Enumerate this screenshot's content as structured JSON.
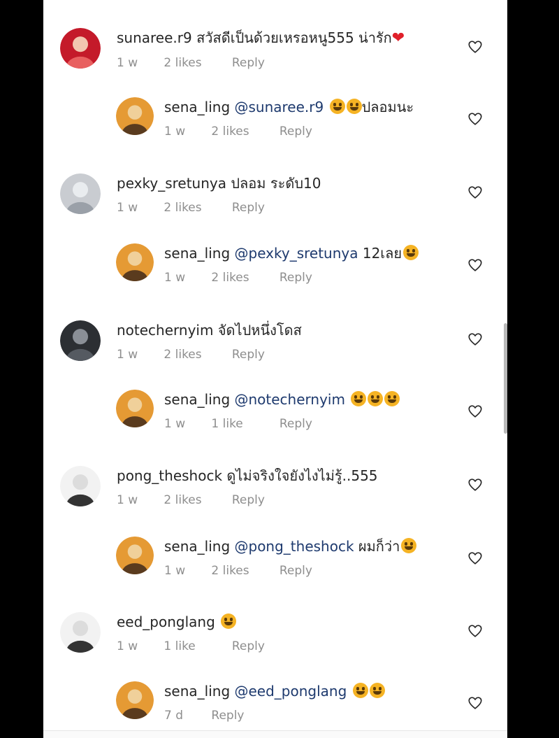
{
  "comments": [
    {
      "kind": "top",
      "user": "sunaree.r9",
      "mention": "",
      "text": "สวัสดีเป็นด้วยเหรอหนู555 น่ารัก",
      "tail": "heart",
      "time": "1 w",
      "likes": "2 likes",
      "reply": "Reply",
      "avatar": "red"
    },
    {
      "kind": "reply",
      "user": "sena_ling",
      "mention": "@sunaree.r9",
      "text": "ปลอมนะ",
      "pre_emoji": 2,
      "time": "1 w",
      "likes": "2 likes",
      "reply": "Reply",
      "avatar": "orange"
    },
    {
      "kind": "top",
      "user": "pexky_sretunya",
      "mention": "",
      "text": "ปลอม ระดับ10",
      "time": "1 w",
      "likes": "2 likes",
      "reply": "Reply",
      "avatar": "grey"
    },
    {
      "kind": "reply",
      "user": "sena_ling",
      "mention": "@pexky_sretunya",
      "text": "12เลย",
      "post_emoji": 1,
      "time": "1 w",
      "likes": "2 likes",
      "reply": "Reply",
      "avatar": "orange"
    },
    {
      "kind": "top",
      "user": "notechernyim",
      "mention": "",
      "text": "จัดไปหนึ่งโดส",
      "time": "1 w",
      "likes": "2 likes",
      "reply": "Reply",
      "avatar": "dark"
    },
    {
      "kind": "reply",
      "user": "sena_ling",
      "mention": "@notechernyim",
      "text": "",
      "post_emoji": 3,
      "time": "1 w",
      "likes": "1 like",
      "reply": "Reply",
      "avatar": "orange"
    },
    {
      "kind": "top",
      "user": "pong_theshock",
      "mention": "",
      "text": "ดูไม่จริงใจยังไงไม่รู้..555",
      "time": "1 w",
      "likes": "2 likes",
      "reply": "Reply",
      "avatar": "white"
    },
    {
      "kind": "reply",
      "user": "sena_ling",
      "mention": "@pong_theshock",
      "text": "ผมก็ว่า",
      "post_emoji": 1,
      "time": "1 w",
      "likes": "2 likes",
      "reply": "Reply",
      "avatar": "orange"
    },
    {
      "kind": "top",
      "user": "eed_ponglang",
      "mention": "",
      "text": "",
      "post_emoji": 1,
      "time": "1 w",
      "likes": "1 like",
      "reply": "Reply",
      "avatar": "white"
    },
    {
      "kind": "reply",
      "user": "sena_ling",
      "mention": "@eed_ponglang",
      "text": "",
      "post_emoji": 2,
      "time": "7 d",
      "likes": "",
      "reply": "Reply",
      "avatar": "orange"
    }
  ],
  "colors": {
    "username": "#262626",
    "mention": "#1e3a6e",
    "meta": "#8e8e8e",
    "red_heart": "#e0202a",
    "emoji": "#f5b324"
  },
  "icons": {
    "like": "heart-outline-icon",
    "emoji": "grin-emoji-icon",
    "red_heart": "red-heart-emoji"
  }
}
